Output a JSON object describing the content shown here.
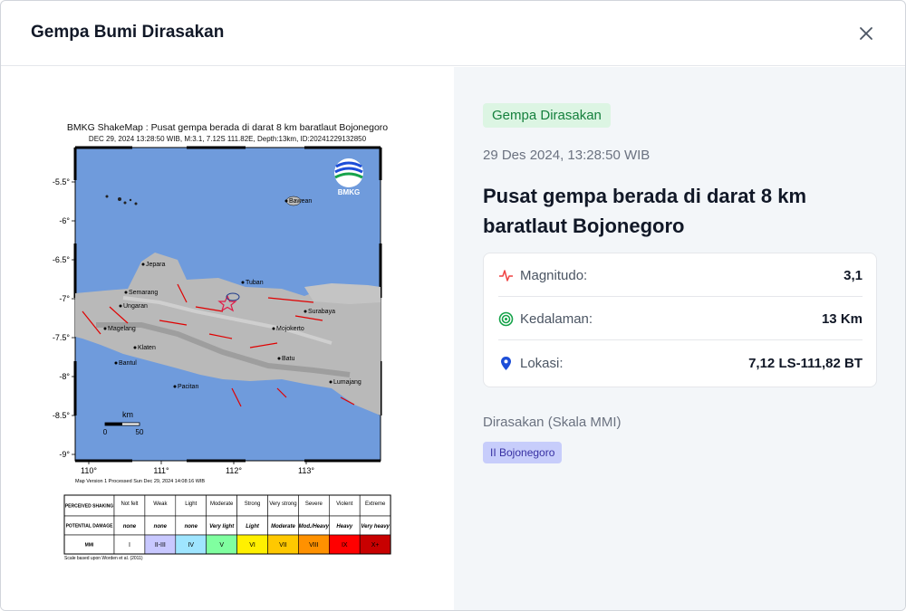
{
  "header": {
    "title": "Gempa Bumi Dirasakan"
  },
  "icons": {
    "close": "close-icon",
    "magnitude": "activity-icon",
    "depth": "target-icon",
    "location": "map-pin-icon"
  },
  "colors": {
    "badge_bg": "#dcf5e3",
    "badge_text": "#15803d",
    "magnitude_icon": "#ef4444",
    "depth_icon": "#16a34a",
    "location_icon": "#1d4ed8",
    "chip_bg": "#c7cdfb"
  },
  "map": {
    "title": "BMKG ShakeMap : Pusat gempa berada di darat 8 km baratlaut Bojonegoro",
    "subtitle": "DEC 29, 2024 13:28:50 WIB, M:3.1, 7.12S 111.82E, Depth:13km, ID:20241229132850",
    "y_ticks": [
      "-5.5°",
      "-6°",
      "-6.5°",
      "-7°",
      "-7.5°",
      "-8°",
      "-8.5°",
      "-9°"
    ],
    "x_ticks": [
      "110°",
      "111°",
      "112°",
      "113°"
    ],
    "cities": [
      "Bawean",
      "Jepara",
      "Semarang",
      "Ungaran",
      "Tuban",
      "Surabaya",
      "Mojokerto",
      "Magelang",
      "Klaten",
      "Bantul",
      "Batu",
      "Pacitan",
      "Lumajang"
    ],
    "logo_text": "BMKG",
    "scale_unit": "km",
    "scale_ticks": [
      "0",
      "50"
    ],
    "footer": "Map Version 1 Processed Sun Dec 29, 2024 14:08:16 WIB",
    "legend": {
      "row_labels": [
        "PERCEIVED SHAKING",
        "POTENTIAL DAMAGE",
        "MMI"
      ],
      "shaking": [
        "Not felt",
        "Weak",
        "Light",
        "Moderate",
        "Strong",
        "Very strong",
        "Severe",
        "Violent",
        "Extreme"
      ],
      "damage": [
        "none",
        "none",
        "none",
        "Very light",
        "Light",
        "Moderate",
        "Mod./Heavy",
        "Heavy",
        "Very heavy"
      ],
      "mmi": [
        "I",
        "II-III",
        "IV",
        "V",
        "VI",
        "VII",
        "VIII",
        "IX",
        "X+"
      ],
      "mmi_colors": [
        "#ffffff",
        "#c8c8ff",
        "#9fe5ff",
        "#80ffa0",
        "#fff000",
        "#ffc800",
        "#ff9100",
        "#ff0000",
        "#c80000"
      ],
      "note": "Scale based upon Worden et al. (2011)"
    }
  },
  "detail": {
    "badge": "Gempa Dirasakan",
    "datetime": "29 Des 2024, 13:28:50 WIB",
    "headline": "Pusat gempa berada di darat 8 km baratlaut Bojonegoro",
    "magnitude_label": "Magnitudo:",
    "magnitude_value": "3,1",
    "depth_label": "Kedalaman:",
    "depth_value": "13 Km",
    "location_label": "Lokasi:",
    "location_value": "7,12 LS-111,82 BT",
    "felt_title": "Dirasakan (Skala MMI)",
    "felt_items": [
      "II Bojonegoro"
    ]
  }
}
